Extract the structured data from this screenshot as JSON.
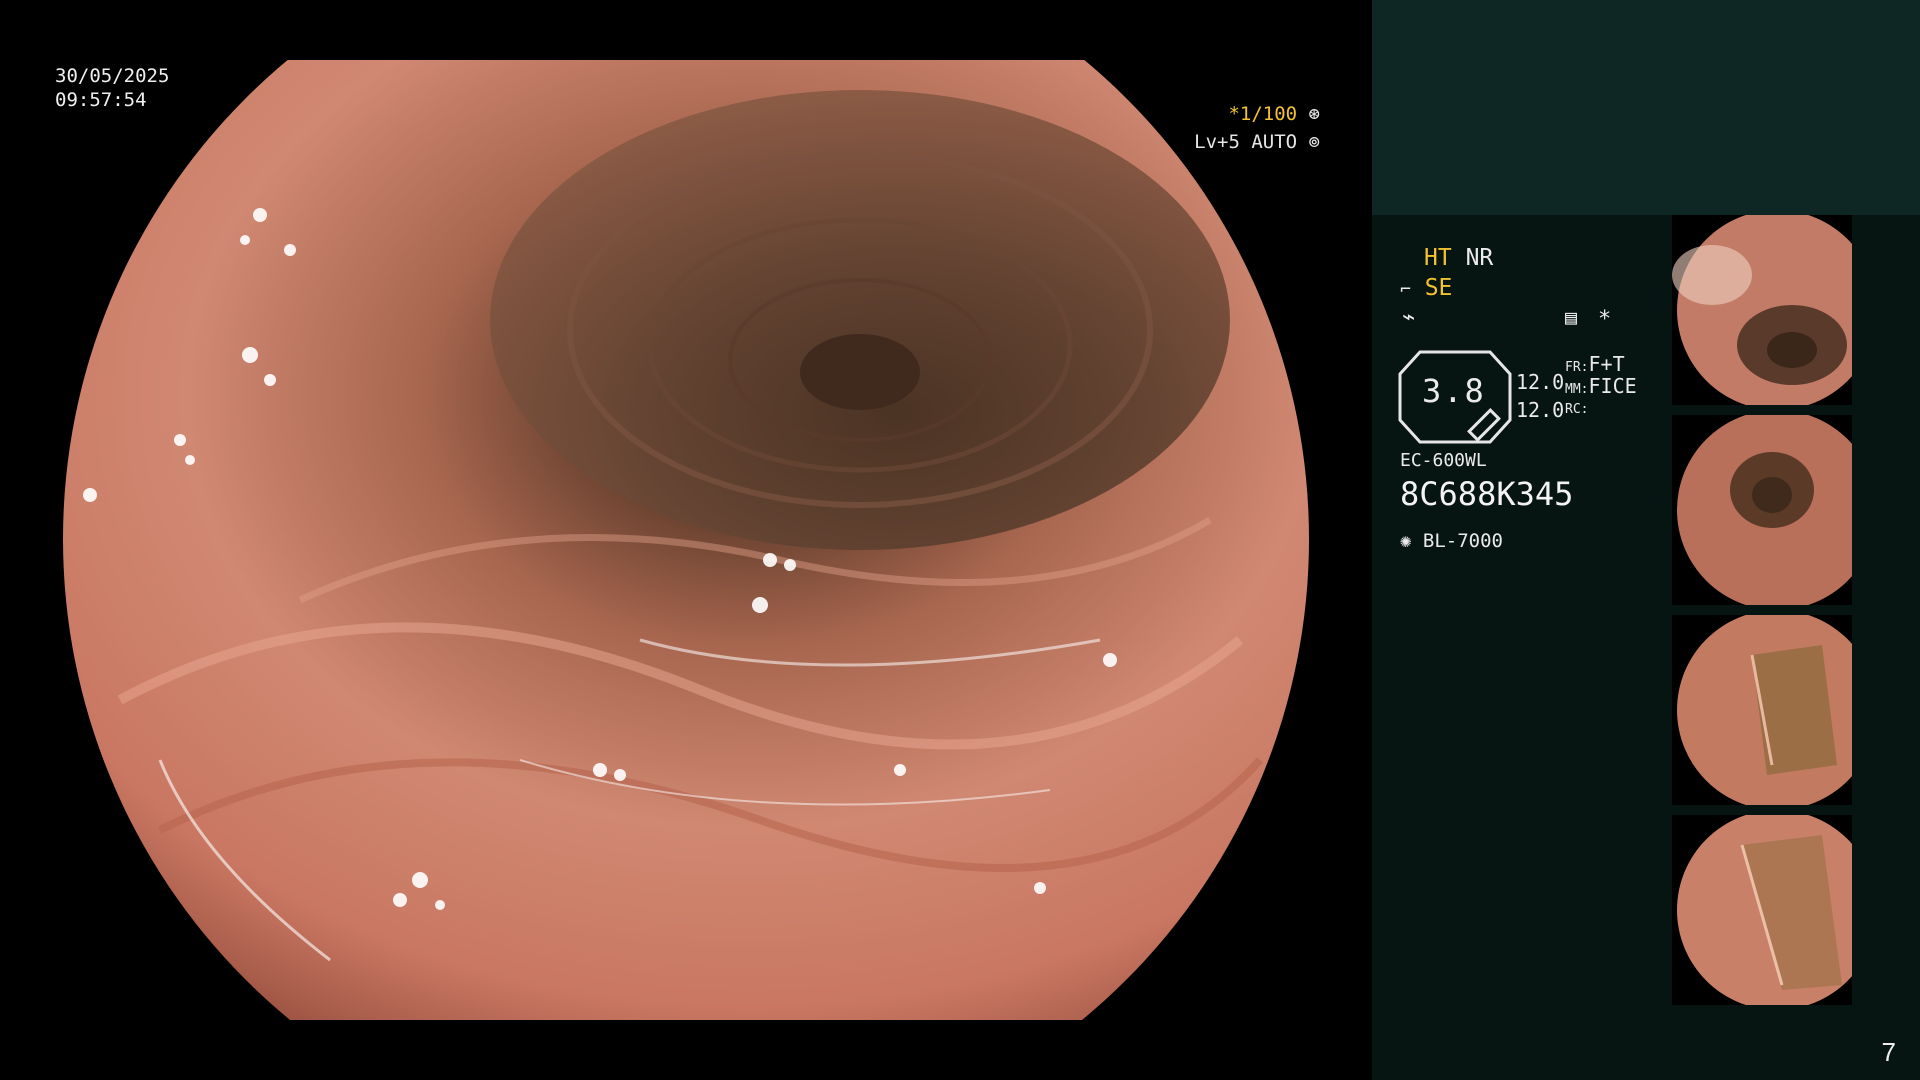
{
  "overlay": {
    "date": "30/05/2025",
    "time": "09:57:54",
    "shutter": "*1/100",
    "level": "Lv+5 AUTO"
  },
  "panel": {
    "ht_label": "HT",
    "nr_label": "NR",
    "se_label": "SE",
    "zoom_value": "3.8",
    "focal_1": "12.0",
    "focal_2": "12.0",
    "fr_label": "FR:",
    "fr_value": "F+T",
    "mm_label": "MM:",
    "mm_value": "FICE",
    "rc_label": "RC:",
    "scope_model": "EC-600WL",
    "serial": "8C688K345",
    "light_source": "BL-7000",
    "star": "*"
  },
  "thumbnails": [
    {
      "name": "capture-1"
    },
    {
      "name": "capture-2"
    },
    {
      "name": "capture-3"
    },
    {
      "name": "capture-4"
    }
  ],
  "page_number": "7",
  "colors": {
    "overlay_yellow": "#f2c230",
    "panel_bg": "#061412",
    "panel_top_bg": "#0e2724",
    "mucosa": "#c87d67"
  }
}
